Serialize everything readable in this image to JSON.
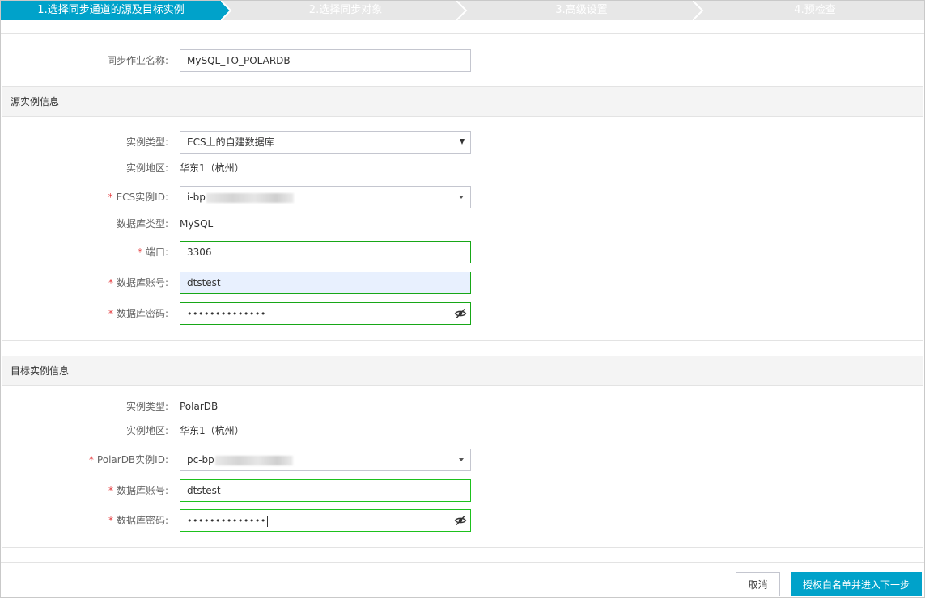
{
  "steps": [
    {
      "label": "1.选择同步通道的源及目标实例",
      "active": true
    },
    {
      "label": "2.选择同步对象",
      "active": false
    },
    {
      "label": "3.高级设置",
      "active": false
    },
    {
      "label": "4.预检查",
      "active": false
    }
  ],
  "job": {
    "name_label": "同步作业名称:",
    "name_value": "MySQL_TO_POLARDB"
  },
  "source": {
    "section_title": "源实例信息",
    "instance_type_label": "实例类型:",
    "instance_type_value": "ECS上的自建数据库",
    "region_label": "实例地区:",
    "region_value": "华东1（杭州）",
    "ecs_id_label": "ECS实例ID:",
    "ecs_id_prefix": "i-bp",
    "db_type_label": "数据库类型:",
    "db_type_value": "MySQL",
    "port_label": "端口:",
    "port_value": "3306",
    "account_label": "数据库账号:",
    "account_value": "dtstest",
    "password_label": "数据库密码:",
    "password_value": "••••••••••••••"
  },
  "target": {
    "section_title": "目标实例信息",
    "instance_type_label": "实例类型:",
    "instance_type_value": "PolarDB",
    "region_label": "实例地区:",
    "region_value": "华东1（杭州）",
    "polardb_id_label": "PolarDB实例ID:",
    "polardb_id_prefix": "pc-bp",
    "account_label": "数据库账号:",
    "account_value": "dtstest",
    "password_label": "数据库密码:",
    "password_value": "••••••••••••••"
  },
  "footer": {
    "cancel_label": "取消",
    "next_label": "授权白名单并进入下一步"
  },
  "required_mark": "*",
  "colors": {
    "accent": "#00a2ca",
    "valid_border": "#1dc11d",
    "required": "#e4393c",
    "autofill_bg": "#e8f0fe",
    "section_bg": "#f4f4f4"
  },
  "icons": {
    "password_toggle": "eye-off-icon",
    "dropdown": "chevron-down-icon",
    "select": "select-arrow-icon"
  }
}
